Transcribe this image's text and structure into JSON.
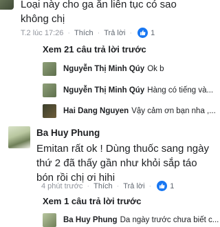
{
  "top_comment": {
    "lines": [
      "Loại này cho ga ăn liên tục có sao",
      "không chị"
    ],
    "meta": {
      "time": "T.2 lúc 17:26",
      "like": "Thích",
      "reply": "Trả lời",
      "like_count": "1"
    }
  },
  "view_replies_1": "Xem 21 câu trả lời trước",
  "replies": [
    {
      "name": "Nguyễn Thị Minh Qúy",
      "text": "Ok b"
    },
    {
      "name": "Nguyễn Thị Minh Qúy",
      "text": "Hàng có tiếng và..."
    },
    {
      "name": "Hai Dang Nguyen",
      "text": "Vậy cảm ơn bạn nha ,..."
    }
  ],
  "comment2": {
    "name": "Ba Huy Phung",
    "lines": [
      "Emitan rất ok ! Dùng thuốc sang ngày",
      "thứ 2 đã thấy gần như khỏi sắp táo",
      "bón rồi  chị ơi hihi"
    ],
    "meta": {
      "time": "4 phút trước",
      "like": "Thích",
      "reply": "Trả lời",
      "like_count": "1"
    }
  },
  "view_replies_2": "Xem 1 câu trả lời trước",
  "last_reply": {
    "name": "Ba Huy Phung",
    "text": "Da ngày trước chưa biết c..."
  },
  "colors": {
    "accent": "#1877f2",
    "meta": "#90949c",
    "text": "#1c1e21"
  }
}
